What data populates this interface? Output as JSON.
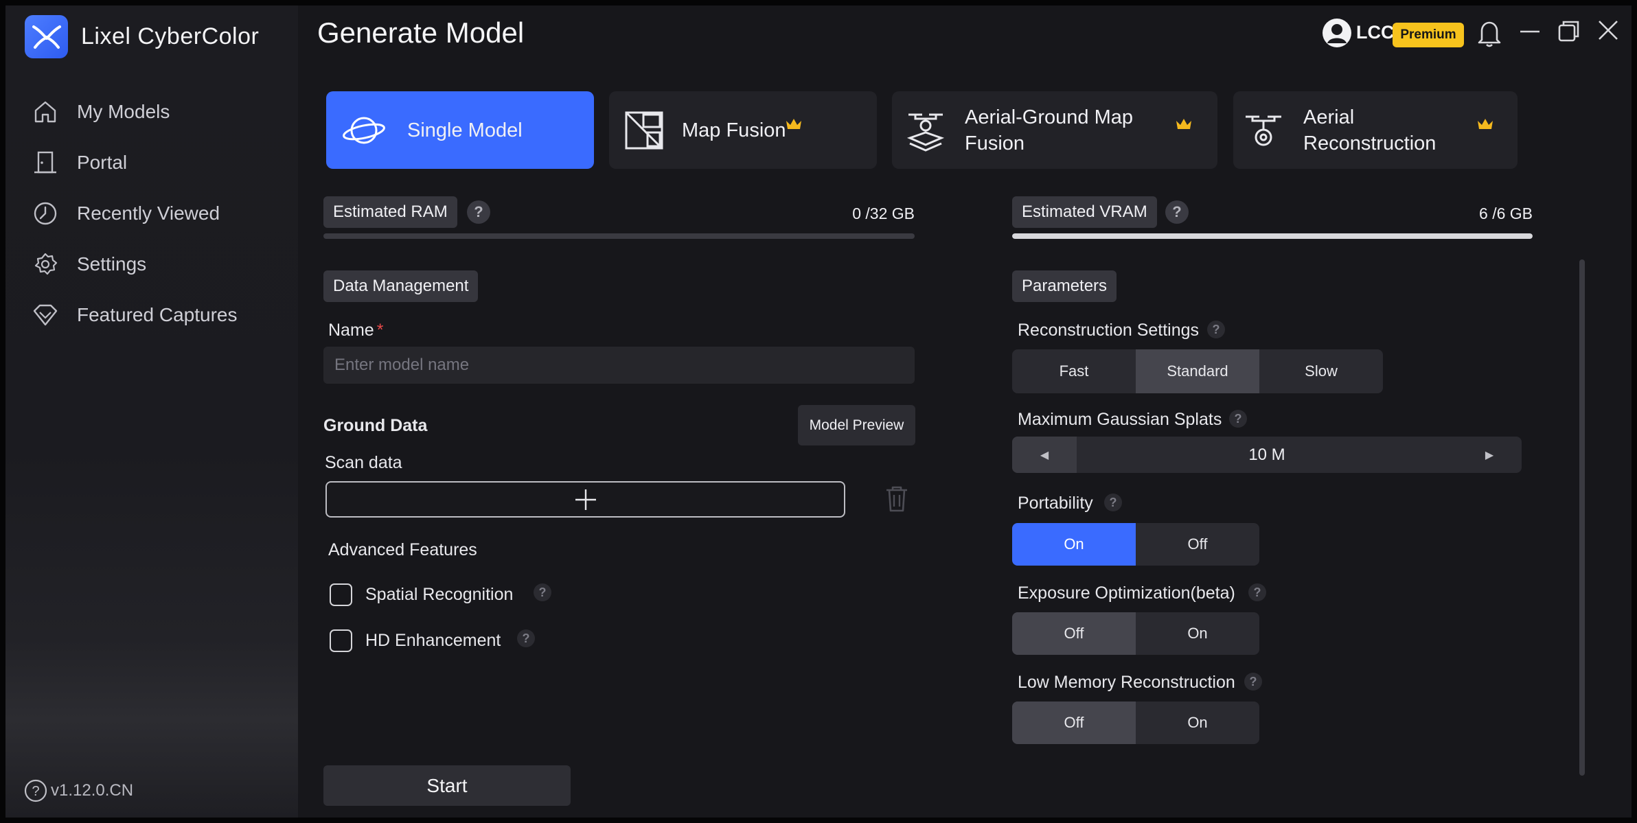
{
  "app": {
    "name": "Lixel CyberColor",
    "version": "v1.12.0.CN"
  },
  "sidebar": {
    "items": [
      {
        "label": "My Models",
        "icon": "home-icon"
      },
      {
        "label": "Portal",
        "icon": "door-icon"
      },
      {
        "label": "Recently Viewed",
        "icon": "clock-icon"
      },
      {
        "label": "Settings",
        "icon": "gear-icon"
      },
      {
        "label": "Featured Captures",
        "icon": "diamond-icon"
      }
    ]
  },
  "header": {
    "title": "Generate Model",
    "user": "LCC",
    "badge": "Premium"
  },
  "modes": [
    {
      "label": "Single Model",
      "active": true,
      "premium": false,
      "icon": "planet-icon"
    },
    {
      "label": "Map Fusion",
      "active": false,
      "premium": true,
      "icon": "map-fusion-icon"
    },
    {
      "label": "Aerial-Ground Map Fusion",
      "active": false,
      "premium": true,
      "icon": "drone-icon"
    },
    {
      "label": "Aerial Reconstruction",
      "active": false,
      "premium": true,
      "icon": "aerial-icon"
    }
  ],
  "memory": {
    "ram": {
      "label": "Estimated RAM",
      "value": "0 /32 GB",
      "fraction": 0.0
    },
    "vram": {
      "label": "Estimated VRAM",
      "value": "6 /6 GB",
      "fraction": 1.0
    }
  },
  "data_management": {
    "section_label": "Data Management",
    "name_label": "Name",
    "name_required": "*",
    "name_placeholder": "Enter model name",
    "name_value": "",
    "ground_data_label": "Ground Data",
    "model_preview_label": "Model Preview",
    "scan_data_label": "Scan data",
    "advanced_label": "Advanced Features",
    "features": [
      {
        "label": "Spatial Recognition",
        "checked": false
      },
      {
        "label": "HD Enhancement",
        "checked": false
      }
    ]
  },
  "parameters": {
    "section_label": "Parameters",
    "reconstruction": {
      "label": "Reconstruction Settings",
      "options": [
        "Fast",
        "Standard",
        "Slow"
      ],
      "selected": "Standard"
    },
    "splats": {
      "label": "Maximum Gaussian Splats",
      "value": "10 M"
    },
    "portability": {
      "label": "Portability",
      "options": [
        "On",
        "Off"
      ],
      "selected": "On"
    },
    "exposure": {
      "label": "Exposure Optimization(beta)",
      "options": [
        "Off",
        "On"
      ],
      "selected": "Off"
    },
    "low_memory": {
      "label": "Low Memory Reconstruction",
      "options": [
        "Off",
        "On"
      ],
      "selected": "Off"
    }
  },
  "actions": {
    "start_label": "Start"
  },
  "colors": {
    "accent": "#3a6bff",
    "premium": "#f7c31d",
    "crown": "#f5b91e"
  }
}
